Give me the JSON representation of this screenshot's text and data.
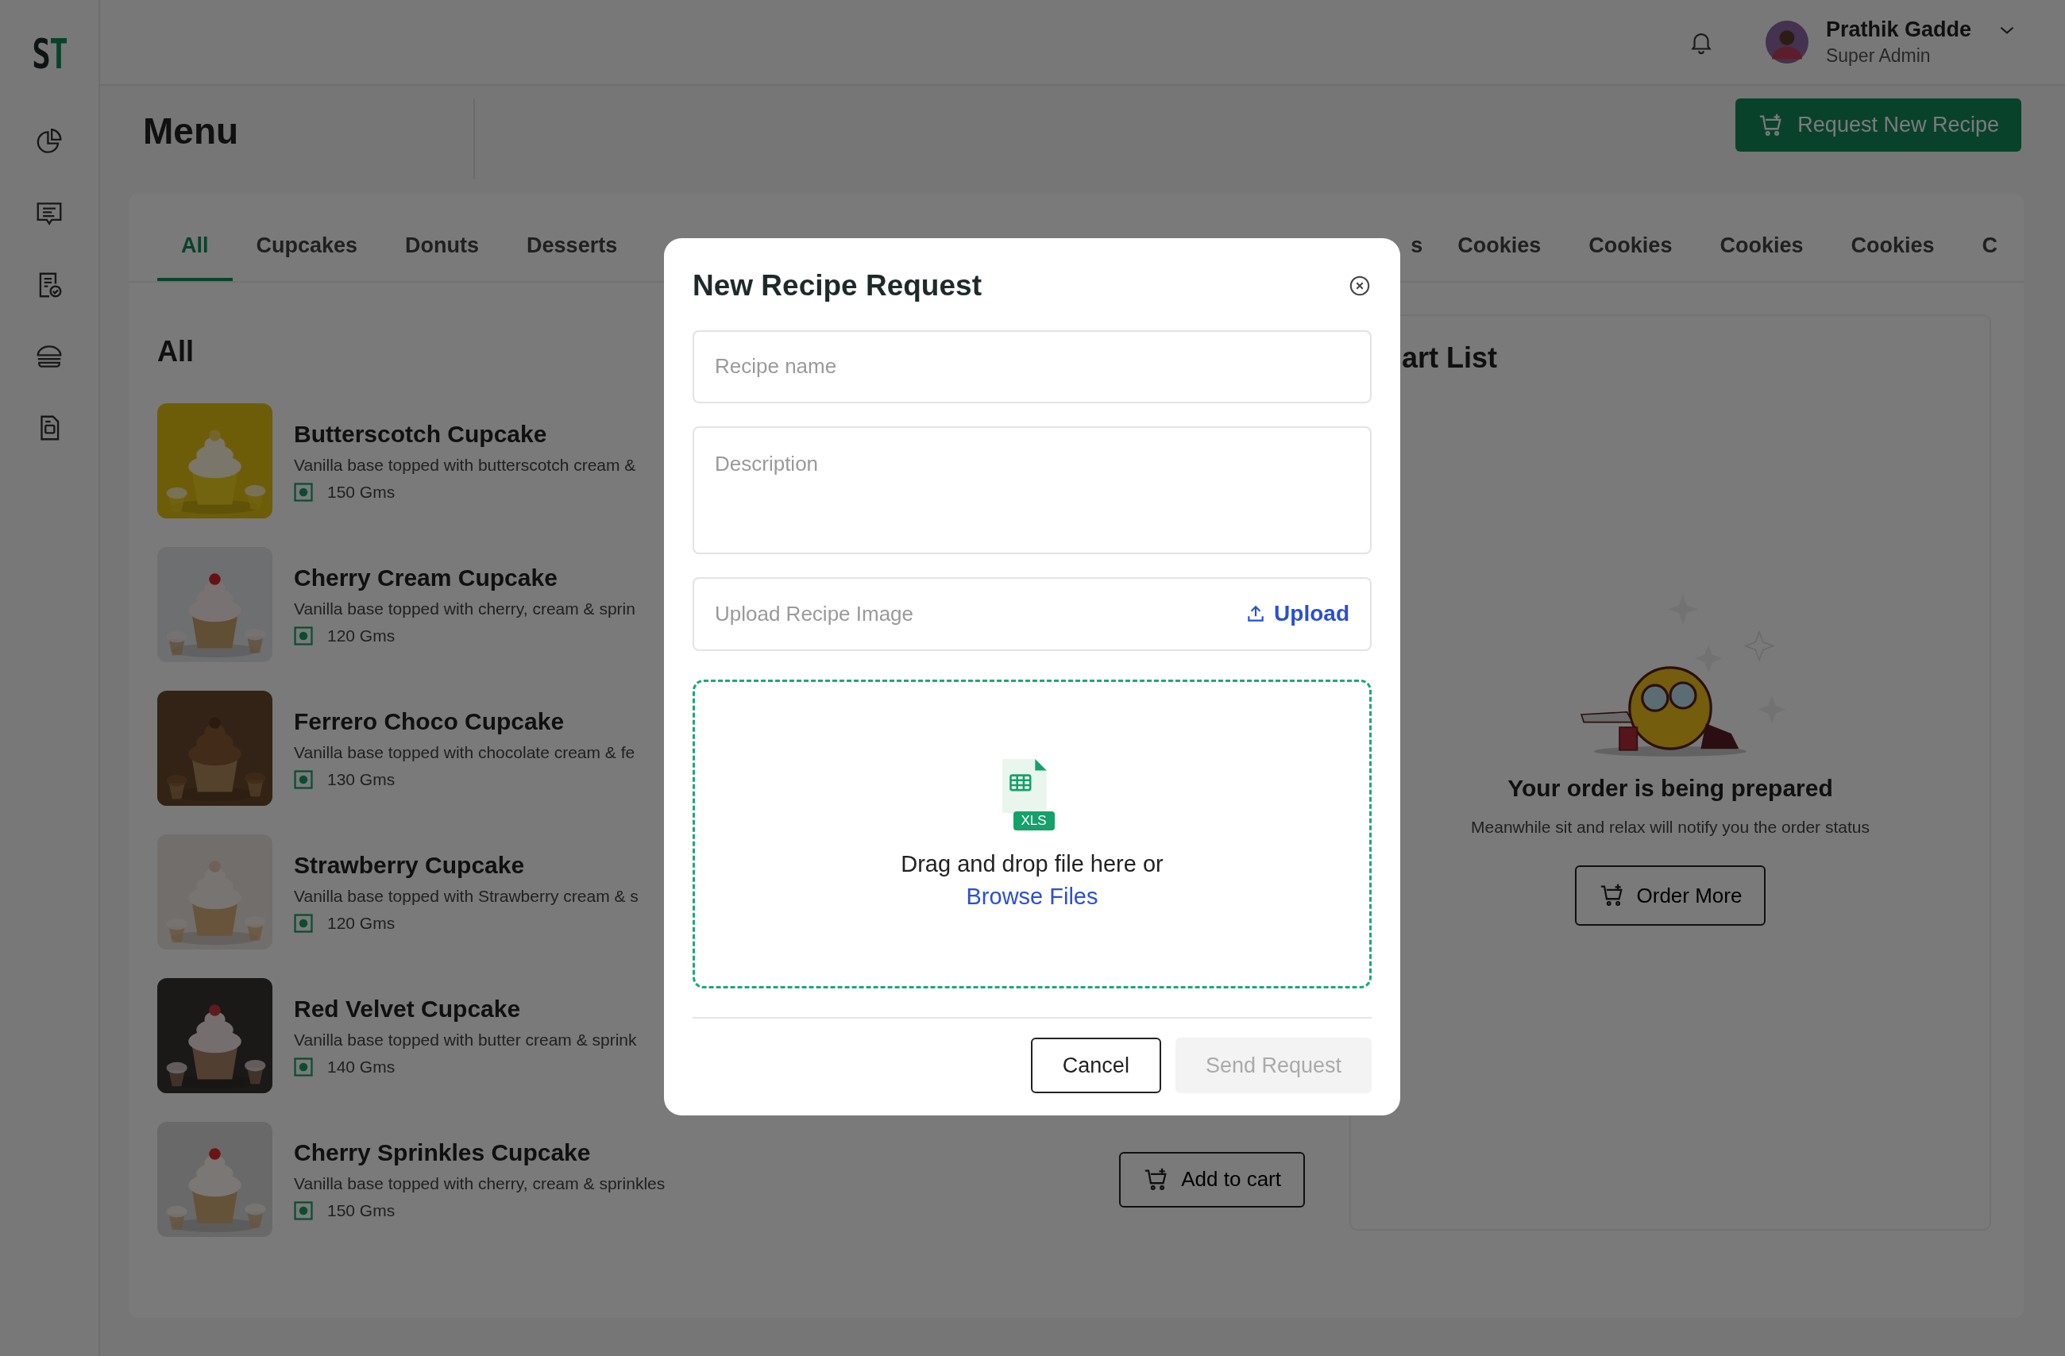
{
  "logo": {
    "left": "S",
    "right": "T"
  },
  "header": {
    "user": {
      "name": "Prathik Gadde",
      "role": "Super Admin"
    }
  },
  "page": {
    "title": "Menu",
    "action": "Request New Recipe"
  },
  "tabs_left": [
    {
      "label": "All",
      "selected": true
    },
    {
      "label": "Cupcakes",
      "selected": false
    },
    {
      "label": "Donuts",
      "selected": false
    },
    {
      "label": "Desserts",
      "selected": false
    }
  ],
  "tabs_right": [
    {
      "label": "s",
      "selected": false
    },
    {
      "label": "Cookies",
      "selected": false
    },
    {
      "label": "Cookies",
      "selected": false
    },
    {
      "label": "Cookies",
      "selected": false
    },
    {
      "label": "Cookies",
      "selected": false
    },
    {
      "label": "C",
      "selected": false
    }
  ],
  "list": {
    "heading": "All",
    "items": [
      {
        "name": "Butterscotch Cupcake",
        "description": "Vanilla base topped with butterscotch cream &",
        "weight": "150 Gms"
      },
      {
        "name": "Cherry Cream Cupcake",
        "description": "Vanilla base topped with cherry, cream & sprin",
        "weight": "120 Gms"
      },
      {
        "name": "Ferrero Choco Cupcake",
        "description": "Vanilla base topped with chocolate cream & fe",
        "weight": "130 Gms"
      },
      {
        "name": "Strawberry Cupcake",
        "description": "Vanilla base topped with Strawberry cream & s",
        "weight": "120 Gms"
      },
      {
        "name": "Red Velvet Cupcake",
        "description": "Vanilla base topped with butter cream & sprink",
        "weight": "140 Gms"
      },
      {
        "name": "Cherry Sprinkles Cupcake",
        "description": "Vanilla base topped with cherry, cream & sprinkles",
        "weight": "150 Gms",
        "button": "Add to cart"
      }
    ]
  },
  "cart": {
    "heading": "art List",
    "title": "Your order is being prepared",
    "subtitle": "Meanwhile sit and relax will notify you the order status",
    "button": "Order More"
  },
  "modal": {
    "title": "New Recipe Request",
    "name_field": {
      "placeholder": "Recipe name"
    },
    "description_field": {
      "placeholder": "Description"
    },
    "upload_field": {
      "placeholder": "Upload Recipe Image",
      "action": "Upload"
    },
    "dropzone": {
      "badge": "XLS",
      "text": "Drag and drop file here or",
      "link": "Browse Files"
    },
    "buttons": [
      {
        "label": "Cancel",
        "kind": "secondary",
        "disabled": false
      },
      {
        "label": "Send Request",
        "kind": "primary",
        "disabled": true
      }
    ]
  }
}
